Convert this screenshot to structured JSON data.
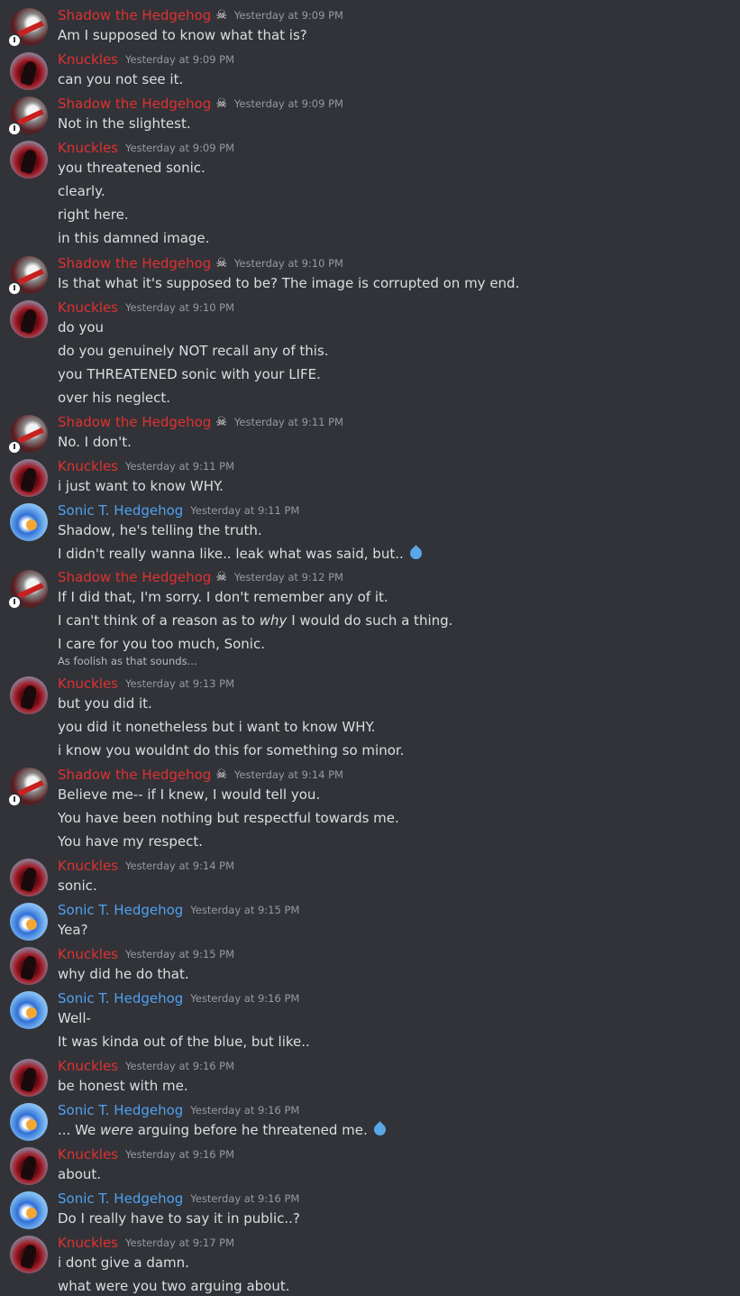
{
  "colors": {
    "background": "#313338",
    "text": "#dbdee1",
    "timestamp": "#949ba4",
    "shadow_name": "#e03131",
    "knuckles_name": "#e03131",
    "sonic_name": "#4ea1f1"
  },
  "icons": {
    "role_icon": "☠",
    "emoji": "droplet-emoji"
  },
  "messages": [
    {
      "author": "Shadow the Hedgehog",
      "avatar": "shadow",
      "time": "Yesterday at 9:09 PM",
      "lines": [
        "Am I supposed to know what that is?"
      ]
    },
    {
      "author": "Knuckles",
      "avatar": "knuckles",
      "time": "Yesterday at 9:09 PM",
      "lines": [
        "can you not see it."
      ]
    },
    {
      "author": "Shadow the Hedgehog",
      "avatar": "shadow",
      "time": "Yesterday at 9:09 PM",
      "lines": [
        "Not in the slightest."
      ]
    },
    {
      "author": "Knuckles",
      "avatar": "knuckles",
      "time": "Yesterday at 9:09 PM",
      "lines": [
        "you threatened sonic.",
        "clearly.",
        "right here.",
        "in this damned image."
      ]
    },
    {
      "author": "Shadow the Hedgehog",
      "avatar": "shadow",
      "time": "Yesterday at 9:10 PM",
      "lines": [
        "Is that what it's supposed to be? The image is corrupted on my end."
      ]
    },
    {
      "author": "Knuckles",
      "avatar": "knuckles",
      "time": "Yesterday at 9:10 PM",
      "lines": [
        "do you",
        "do you genuinely NOT recall any of this.",
        "you THREATENED sonic with your LIFE.",
        "over his neglect."
      ]
    },
    {
      "author": "Shadow the Hedgehog",
      "avatar": "shadow",
      "time": "Yesterday at 9:11 PM",
      "lines": [
        "No. I don't."
      ]
    },
    {
      "author": "Knuckles",
      "avatar": "knuckles",
      "time": "Yesterday at 9:11 PM",
      "lines": [
        "i just want to know WHY."
      ]
    },
    {
      "author": "Sonic T. Hedgehog",
      "avatar": "sonic",
      "time": "Yesterday at 9:11 PM",
      "lines": [
        "Shadow, he's telling the truth.",
        "I didn't really wanna like.. leak what was said, but.."
      ]
    },
    {
      "author": "Shadow the Hedgehog",
      "avatar": "shadow",
      "time": "Yesterday at 9:12 PM",
      "lines": [
        "If I did that, I'm sorry. I don't remember any of it.",
        "I can't think of a reason as to",
        "why",
        " I would do such a thing.",
        "I care for you too much, Sonic.",
        "As foolish as that sounds..."
      ]
    },
    {
      "author": "Knuckles",
      "avatar": "knuckles",
      "time": "Yesterday at 9:13 PM",
      "lines": [
        "but you did it.",
        "you did it nonetheless but i want to know WHY.",
        "i know you wouldnt do this for something so minor."
      ]
    },
    {
      "author": "Shadow the Hedgehog",
      "avatar": "shadow",
      "time": "Yesterday at 9:14 PM",
      "lines": [
        "Believe me-- if I knew, I would tell you.",
        "You have been nothing but respectful towards me.",
        "You have my respect."
      ]
    },
    {
      "author": "Knuckles",
      "avatar": "knuckles",
      "time": "Yesterday at 9:14 PM",
      "lines": [
        "sonic."
      ]
    },
    {
      "author": "Sonic T. Hedgehog",
      "avatar": "sonic",
      "time": "Yesterday at 9:15 PM",
      "lines": [
        "Yea?"
      ]
    },
    {
      "author": "Knuckles",
      "avatar": "knuckles",
      "time": "Yesterday at 9:15 PM",
      "lines": [
        "why did he do that."
      ]
    },
    {
      "author": "Sonic T. Hedgehog",
      "avatar": "sonic",
      "time": "Yesterday at 9:16 PM",
      "lines": [
        "Well-",
        "It was kinda out of the blue, but like.."
      ]
    },
    {
      "author": "Knuckles",
      "avatar": "knuckles",
      "time": "Yesterday at 9:16 PM",
      "lines": [
        "be honest with me."
      ]
    },
    {
      "author": "Sonic T. Hedgehog",
      "avatar": "sonic",
      "time": "Yesterday at 9:16 PM",
      "lines": [
        "... We",
        "were",
        " arguing before he threatened me."
      ]
    },
    {
      "author": "Knuckles",
      "avatar": "knuckles",
      "time": "Yesterday at 9:16 PM",
      "lines": [
        "about."
      ]
    },
    {
      "author": "Sonic T. Hedgehog",
      "avatar": "sonic",
      "time": "Yesterday at 9:16 PM",
      "lines": [
        "Do I really have to say it in public..?"
      ]
    },
    {
      "author": "Knuckles",
      "avatar": "knuckles",
      "time": "Yesterday at 9:17 PM",
      "lines": [
        "i dont give a damn.",
        "what were you two arguing about."
      ]
    }
  ]
}
